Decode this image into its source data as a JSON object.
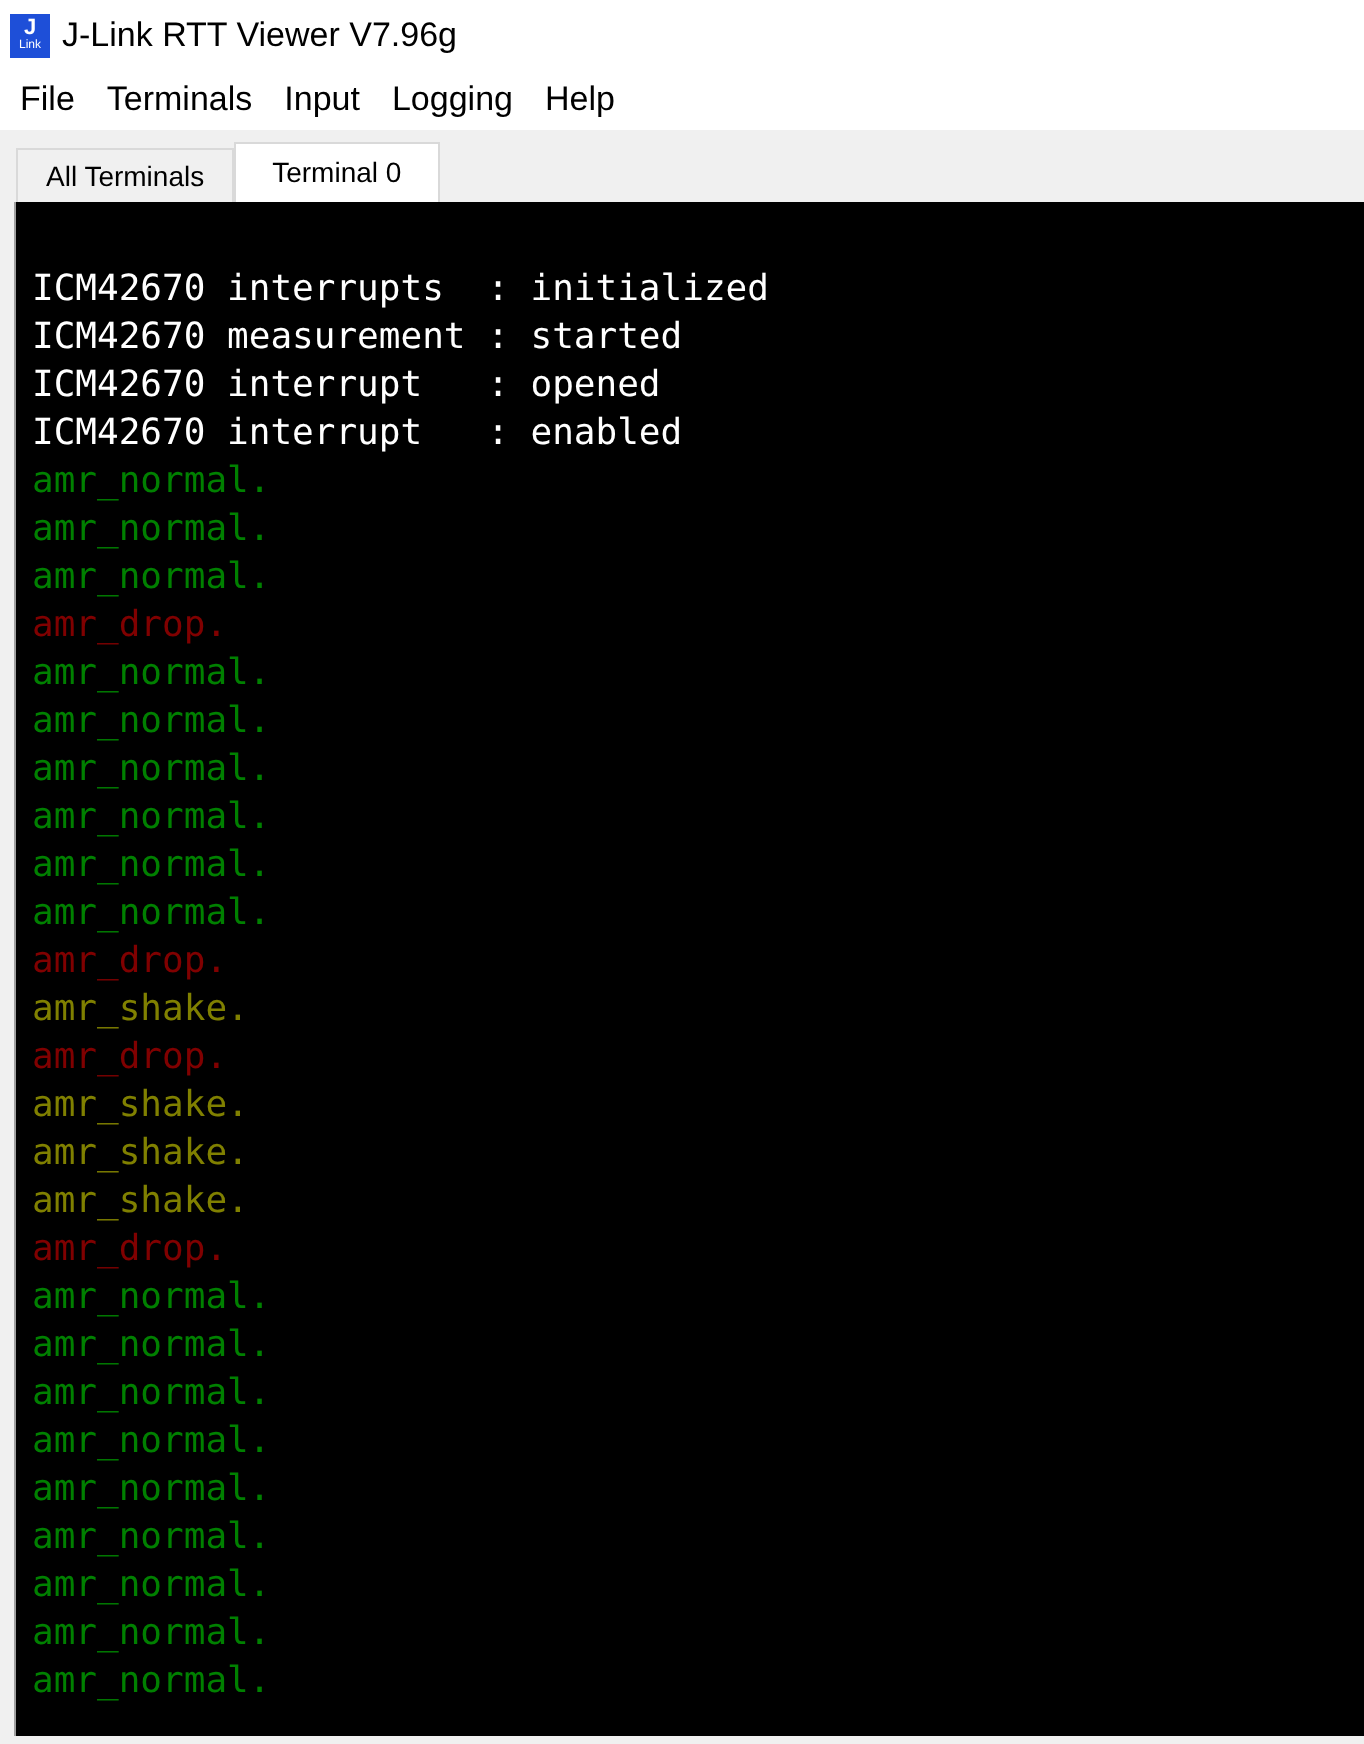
{
  "window": {
    "title": "J-Link RTT Viewer V7.96g",
    "logo": {
      "top": "J",
      "bottom": "Link"
    }
  },
  "menu": [
    "File",
    "Terminals",
    "Input",
    "Logging",
    "Help"
  ],
  "tabs": [
    {
      "label": "All Terminals",
      "selected": false
    },
    {
      "label": "Terminal 0",
      "selected": true
    }
  ],
  "terminal": {
    "lines": [
      {
        "text": "ICM42670 interrupts  : initialized",
        "color": "#ffffff"
      },
      {
        "text": "ICM42670 measurement : started",
        "color": "#ffffff"
      },
      {
        "text": "ICM42670 interrupt   : opened",
        "color": "#ffffff"
      },
      {
        "text": "ICM42670 interrupt   : enabled",
        "color": "#ffffff"
      },
      {
        "text": "amr_normal.",
        "color": "#008000"
      },
      {
        "text": "amr_normal.",
        "color": "#008000"
      },
      {
        "text": "amr_normal.",
        "color": "#008000"
      },
      {
        "text": "amr_drop.",
        "color": "#800000"
      },
      {
        "text": "amr_normal.",
        "color": "#008000"
      },
      {
        "text": "amr_normal.",
        "color": "#008000"
      },
      {
        "text": "amr_normal.",
        "color": "#008000"
      },
      {
        "text": "amr_normal.",
        "color": "#008000"
      },
      {
        "text": "amr_normal.",
        "color": "#008000"
      },
      {
        "text": "amr_normal.",
        "color": "#008000"
      },
      {
        "text": "amr_drop.",
        "color": "#800000"
      },
      {
        "text": "amr_shake.",
        "color": "#808000"
      },
      {
        "text": "amr_drop.",
        "color": "#800000"
      },
      {
        "text": "amr_shake.",
        "color": "#808000"
      },
      {
        "text": "amr_shake.",
        "color": "#808000"
      },
      {
        "text": "amr_shake.",
        "color": "#808000"
      },
      {
        "text": "amr_drop.",
        "color": "#800000"
      },
      {
        "text": "amr_normal.",
        "color": "#008000"
      },
      {
        "text": "amr_normal.",
        "color": "#008000"
      },
      {
        "text": "amr_normal.",
        "color": "#008000"
      },
      {
        "text": "amr_normal.",
        "color": "#008000"
      },
      {
        "text": "amr_normal.",
        "color": "#008000"
      },
      {
        "text": "amr_normal.",
        "color": "#008000"
      },
      {
        "text": "amr_normal.",
        "color": "#008000"
      },
      {
        "text": "amr_normal.",
        "color": "#008000"
      },
      {
        "text": "amr_normal.",
        "color": "#008000"
      }
    ]
  }
}
